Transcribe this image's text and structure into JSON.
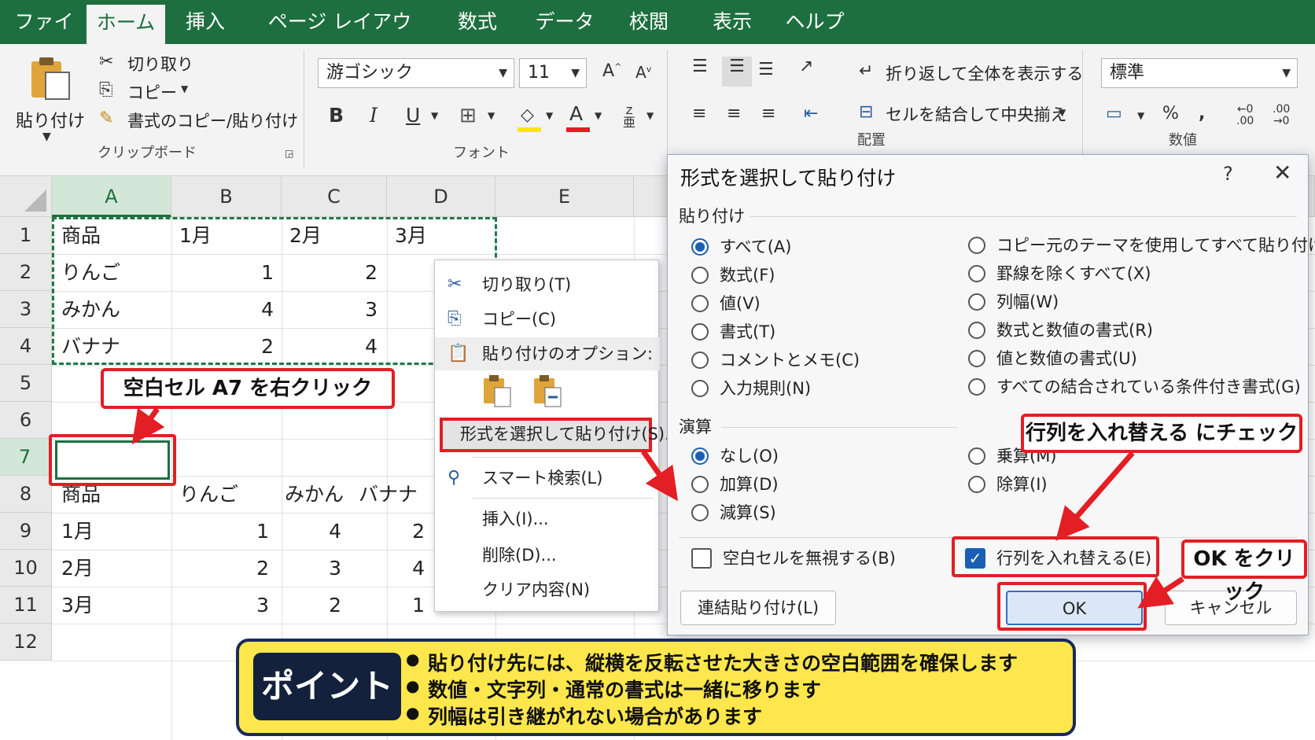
{
  "ribbon_tabs": [
    "ファイル",
    "ホーム",
    "挿入",
    "ページ レイアウト",
    "数式",
    "データ",
    "校閲",
    "表示",
    "ヘルプ"
  ],
  "ribbon": {
    "paste_label": "貼り付け",
    "cut_label": "切り取り",
    "copy_label": "コピー",
    "format_painter_label": "書式のコピー/貼り付け",
    "clipboard_group": "クリップボード",
    "font_name": "游ゴシック",
    "font_size": "11",
    "font_group": "フォント",
    "wrap_text_label": "折り返して全体を表示する",
    "merge_center_label": "セルを結合して中央揃え",
    "alignment_group": "配置",
    "number_format": "標準",
    "number_group": "数値"
  },
  "grid": {
    "columns": [
      "A",
      "B",
      "C",
      "D",
      "E"
    ],
    "rows": [
      "1",
      "2",
      "3",
      "4",
      "5",
      "6",
      "7",
      "8",
      "9",
      "10",
      "11",
      "12"
    ],
    "source_table": [
      [
        "商品",
        "1月",
        "2月",
        "3月"
      ],
      [
        "りんご",
        "1",
        "2",
        ""
      ],
      [
        "みかん",
        "4",
        "3",
        ""
      ],
      [
        "バナナ",
        "2",
        "4",
        ""
      ]
    ],
    "result_table": [
      [
        "商品",
        "りんご",
        "みかん",
        "バナナ"
      ],
      [
        "1月",
        "1",
        "4",
        "2"
      ],
      [
        "2月",
        "2",
        "3",
        "4"
      ],
      [
        "3月",
        "3",
        "2",
        "1"
      ]
    ]
  },
  "callouts": {
    "right_click": "空白セル A7 を右クリック",
    "check_transpose": "行列を入れ替える にチェック",
    "click_ok": "OK をクリック"
  },
  "context_menu": {
    "cut": "切り取り(T)",
    "copy": "コピー(C)",
    "paste_options": "貼り付けのオプション:",
    "paste_special": "形式を選択して貼り付け(S)...",
    "smart_lookup": "スマート検索(L)",
    "insert": "挿入(I)...",
    "delete": "削除(D)...",
    "clear": "クリア内容(N)"
  },
  "dialog": {
    "title": "形式を選択して貼り付け",
    "help": "?",
    "close": "✕",
    "paste_section": "貼り付け",
    "paste_options_left": [
      "すべて(A)",
      "数式(F)",
      "値(V)",
      "書式(T)",
      "コメントとメモ(C)",
      "入力規則(N)"
    ],
    "paste_options_right": [
      "コピー元のテーマを使用してすべて貼り付け(H)",
      "罫線を除くすべて(X)",
      "列幅(W)",
      "数式と数値の書式(R)",
      "値と数値の書式(U)",
      "すべての結合されている条件付き書式(G)"
    ],
    "operation_section": "演算",
    "operation_left": [
      "なし(O)",
      "加算(D)",
      "減算(S)"
    ],
    "operation_right": [
      "乗算(M)",
      "除算(I)"
    ],
    "skip_blanks": "空白セルを無視する(B)",
    "transpose": "行列を入れ替える(E)",
    "paste_link": "連結貼り付け(L)",
    "ok": "OK",
    "cancel": "キャンセル"
  },
  "point": {
    "badge": "ポイント",
    "items": [
      "貼り付け先には、縦横を反転させた大きさの空白範囲を確保します",
      "数値・文字列・通常の書式は一緒に移ります",
      "列幅は引き継がれない場合があります"
    ]
  },
  "colors": {
    "excel_green": "#1e6f3f",
    "highlight_red": "#e31e24",
    "point_yellow": "#fde74c",
    "point_navy": "#14213d",
    "radio_blue": "#1a5fb4"
  }
}
